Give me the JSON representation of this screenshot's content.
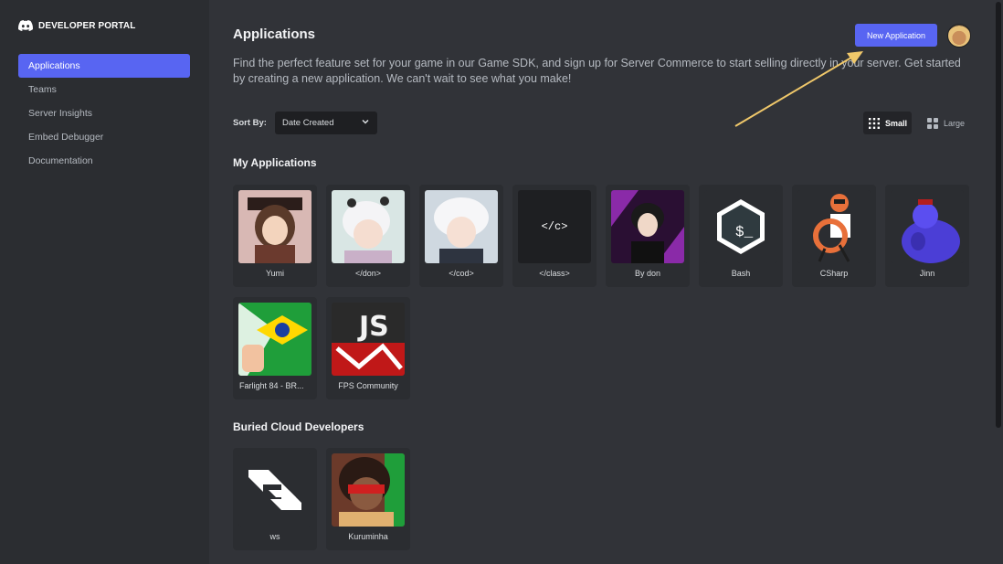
{
  "brand": {
    "label": "DEVELOPER PORTAL"
  },
  "sidebar": {
    "items": [
      {
        "label": "Applications",
        "active": true
      },
      {
        "label": "Teams"
      },
      {
        "label": "Server Insights"
      },
      {
        "label": "Embed Debugger"
      },
      {
        "label": "Documentation"
      }
    ]
  },
  "header": {
    "title": "Applications",
    "new_app_label": "New Application",
    "description": "Find the perfect feature set for your game in our Game SDK, and sign up for Server Commerce to start selling directly in your server. Get started by creating a new application. We can't wait to see what you make!"
  },
  "sort": {
    "label": "Sort By:",
    "value": "Date Created"
  },
  "view": {
    "small_label": "Small",
    "large_label": "Large",
    "selected": "Small"
  },
  "sections": {
    "my_apps": {
      "title": "My Applications",
      "apps": [
        "Yumi",
        "</don>",
        "</cod>",
        "</class>",
        "By don",
        "Bash",
        "CSharp",
        "Jinn",
        "Farlight 84 - BR...",
        "FPS Community"
      ]
    },
    "team": {
      "title": "Buried Cloud Developers",
      "apps": [
        "ws",
        "Kuruminha"
      ]
    }
  },
  "icon_texts": {
    "class_icon": "</c>",
    "fps_icon": "JS"
  },
  "colors": {
    "accent": "#5865f2",
    "annotation_arrow": "#f0c86a"
  }
}
